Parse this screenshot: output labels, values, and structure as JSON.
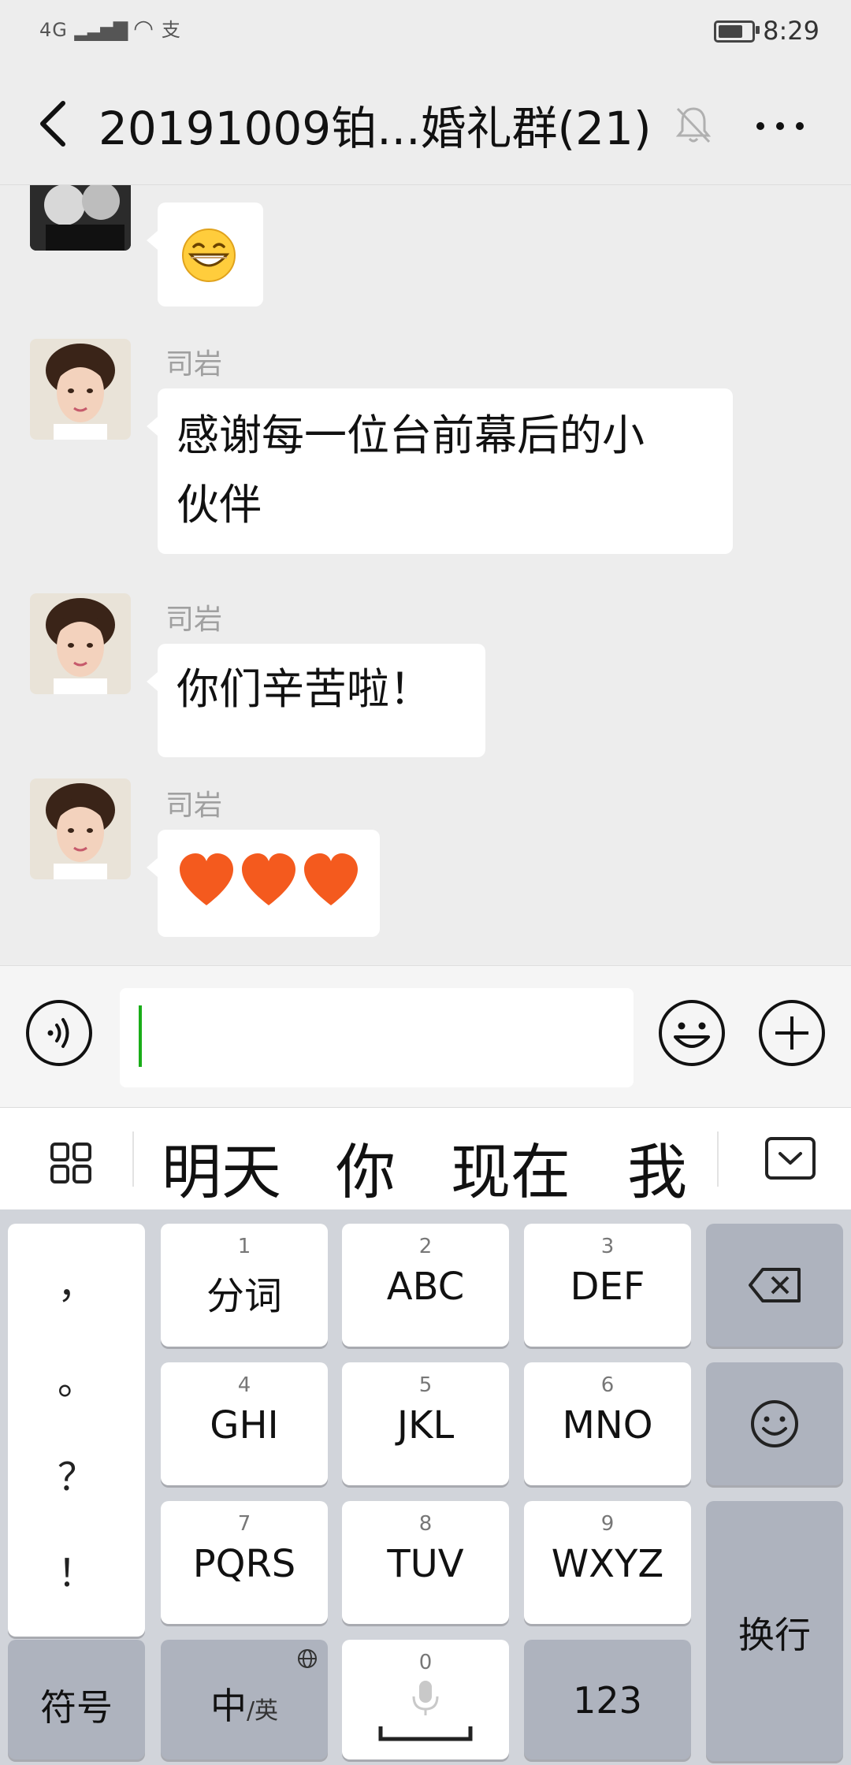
{
  "status_bar": {
    "network": "4G",
    "extra_icon": "支",
    "time": "8:29",
    "battery_level": 0.75
  },
  "header": {
    "title": "20191009铂...婚礼群(21)",
    "icons": [
      "back-arrow-icon",
      "bell-muted-icon",
      "more-icon"
    ]
  },
  "chat": {
    "messages": [
      {
        "sender": "",
        "type": "emoji",
        "content": "grinning-face-emoji"
      },
      {
        "sender": "司岩",
        "type": "text",
        "lines": [
          "感谢每一位台前幕后的小",
          "伙伴"
        ]
      },
      {
        "sender": "司岩",
        "type": "text",
        "lines": [
          "你们辛苦啦！"
        ]
      },
      {
        "sender": "司岩",
        "type": "emoji",
        "content": "three-hearts-emoji"
      }
    ]
  },
  "input_bar": {
    "value": "",
    "placeholder": ""
  },
  "candidates": [
    "明天",
    "你",
    "现在",
    "我"
  ],
  "keyboard": {
    "punct": [
      "，",
      "。",
      "？",
      "！"
    ],
    "row1": [
      {
        "num": "1",
        "label": "分词"
      },
      {
        "num": "2",
        "label": "ABC"
      },
      {
        "num": "3",
        "label": "DEF"
      }
    ],
    "row2": [
      {
        "num": "4",
        "label": "GHI"
      },
      {
        "num": "5",
        "label": "JKL"
      },
      {
        "num": "6",
        "label": "MNO"
      }
    ],
    "row3": [
      {
        "num": "7",
        "label": "PQRS"
      },
      {
        "num": "8",
        "label": "TUV"
      },
      {
        "num": "9",
        "label": "WXYZ"
      }
    ],
    "symbols": "符号",
    "lang_main": "中",
    "lang_alt": "/英",
    "space_num": "0",
    "numbers": "123",
    "enter": "换行"
  },
  "colors": {
    "accent": "#1aad19",
    "background": "#ededed",
    "bubble": "#ffffff",
    "key_gray": "#aeb3be"
  }
}
